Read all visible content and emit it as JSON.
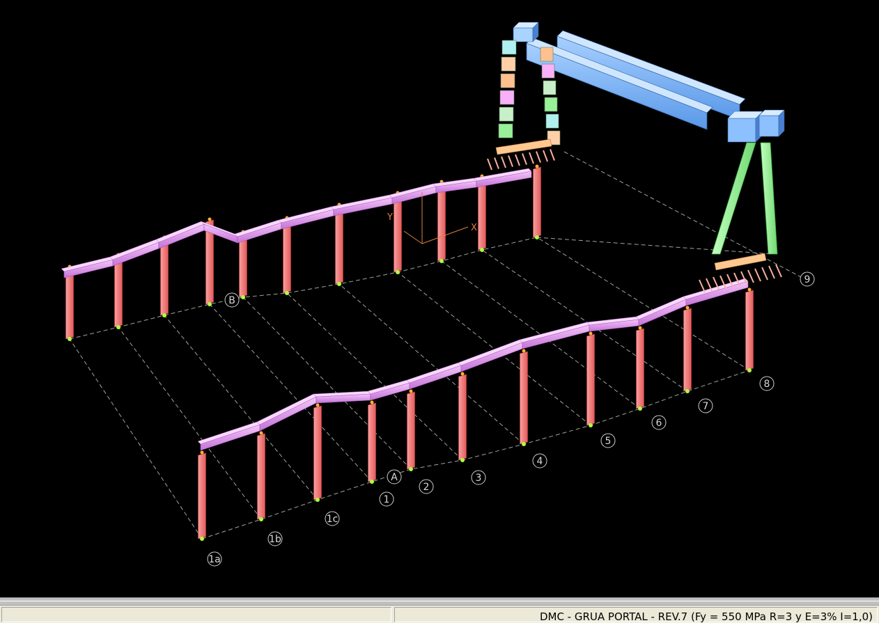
{
  "status": {
    "model_title": "DMC - GRUA PORTAL - REV.7 (Fy = 550 MPa  R=3 y E=3%  I=1,0)"
  },
  "axes": {
    "x": "X",
    "y": "Y"
  },
  "grid_labels_front": [
    "1a",
    "1b",
    "1c",
    "1",
    "A",
    "2",
    "3",
    "4",
    "5",
    "6",
    "7",
    "8"
  ],
  "grid_labels_back": [
    "B",
    "9"
  ],
  "colors": {
    "background": "#000000",
    "column": "#f07070",
    "beam": "#e9a0f0",
    "crane_girder": "#7fb6ff",
    "crane_leg": "#98f098",
    "gridline": "#9aa89a",
    "grid_bubble": "#d0d0d0"
  }
}
